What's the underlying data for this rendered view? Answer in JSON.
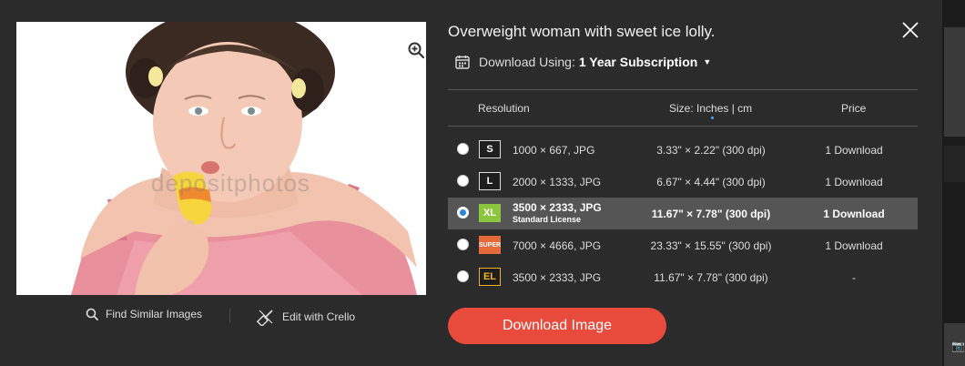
{
  "image": {
    "title": "Overweight woman with sweet ice lolly.",
    "watermark": "depositphotos"
  },
  "image_actions": {
    "find_similar": "Find Similar Images",
    "edit_crello": "Edit with Crello"
  },
  "download_using": {
    "label": "Download Using:",
    "value": "1 Year Subscription"
  },
  "table": {
    "headers": {
      "resolution": "Resolution",
      "size": "Size: Inches | cm",
      "price": "Price"
    },
    "rows": [
      {
        "badge": "S",
        "resolution": "1000 × 667, JPG",
        "license": "",
        "size": "3.33\" × 2.22\" (300 dpi)",
        "price": "1 Download",
        "selected": false
      },
      {
        "badge": "L",
        "resolution": "2000 × 1333, JPG",
        "license": "",
        "size": "6.67\" × 4.44\" (300 dpi)",
        "price": "1 Download",
        "selected": false
      },
      {
        "badge": "XL",
        "resolution": "3500 × 2333, JPG",
        "license": "Standard License",
        "size": "11.67\" × 7.78\" (300 dpi)",
        "price": "1 Download",
        "selected": true
      },
      {
        "badge": "SUPER",
        "resolution": "7000 × 4666, JPG",
        "license": "",
        "size": "23.33\" × 15.55\" (300 dpi)",
        "price": "1 Download",
        "selected": false
      },
      {
        "badge": "EL",
        "resolution": "3500 × 2333, JPG",
        "license": "",
        "size": "11.67\" × 7.78\" (300 dpi)",
        "price": "-",
        "selected": false
      }
    ]
  },
  "download_button": "Download Image",
  "colors": {
    "background": "#2b2b2b",
    "accent_button": "#e84b3c",
    "selected_row": "#555555",
    "badge_xl": "#8cc63f",
    "badge_super": "#e56a3b",
    "badge_el": "#f0b429",
    "radio_selected": "#2d86d8"
  },
  "icons": {
    "zoom": "zoom-in-icon",
    "close": "close-icon",
    "calendar": "calendar-icon",
    "search": "search-icon",
    "crello": "crello-edit-icon"
  }
}
